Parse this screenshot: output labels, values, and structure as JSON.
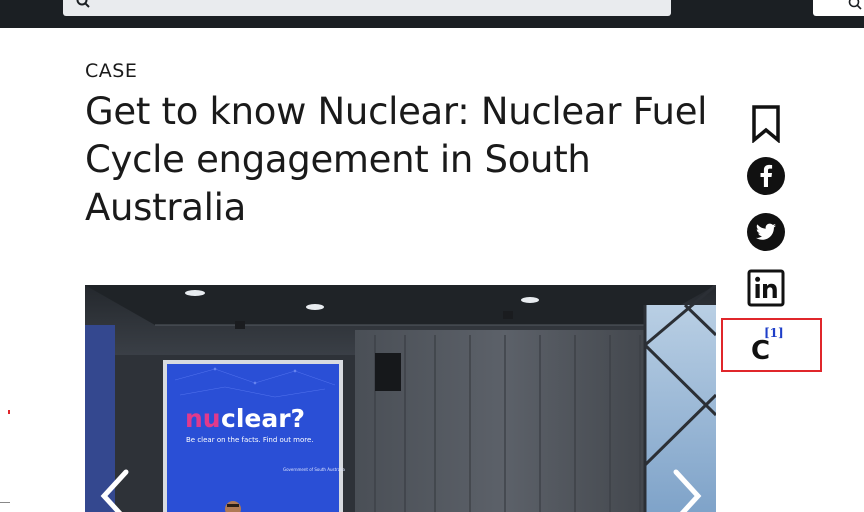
{
  "header": {
    "search_icon": "search-icon",
    "search_button_icon": "search-icon"
  },
  "article": {
    "category": "CASE",
    "title": "Get to know Nuclear: Nuclear Fuel Cycle engagement in South Australia"
  },
  "share": {
    "bookmark_icon": "bookmark-icon",
    "facebook_icon": "facebook-icon",
    "twitter_icon": "twitter-icon",
    "linkedin_icon": "linkedin-icon"
  },
  "citation": {
    "letter": "C",
    "number": "[1]"
  },
  "carousel": {
    "screen_headline_a": "nu",
    "screen_headline_b": "clear?",
    "screen_tagline": "Be clear on the facts. Find out more.",
    "screen_gov_text": "Government of South Australia",
    "accent_color": "#e03a8c",
    "screen_color": "#2a4fd6",
    "prev_icon": "chevron-left-icon",
    "next_icon": "chevron-right-icon"
  }
}
